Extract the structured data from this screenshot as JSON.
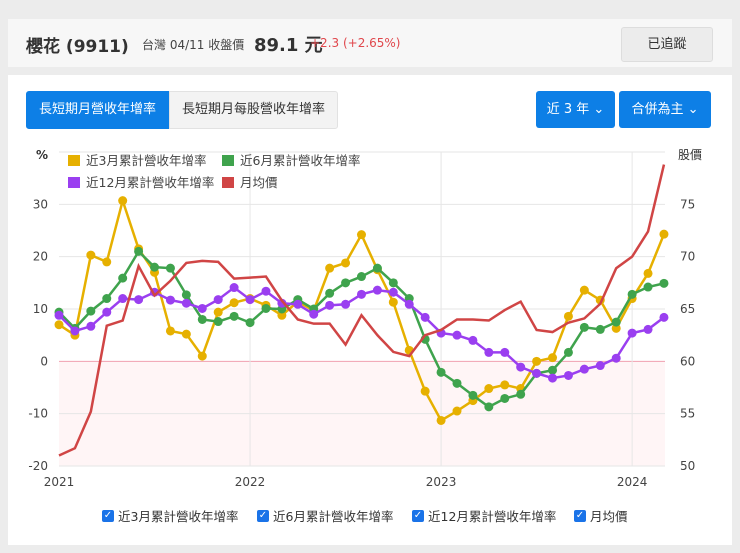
{
  "header": {
    "title": "櫻花 (9911)",
    "market_date": "台灣 04/11 收盤價",
    "price": "89.1 元",
    "change": "+2.3 (+2.65%)",
    "follow_label": "已追蹤"
  },
  "tabs": [
    {
      "label": "長短期月營收年增率"
    },
    {
      "label": "長短期月每股營收年增率"
    }
  ],
  "dropdowns": {
    "period": "近 3 年",
    "basis": "合併為主"
  },
  "colors": {
    "m3": "#e6b000",
    "m6": "#3fa34d",
    "m12": "#9a3ff0",
    "price": "#d04545"
  },
  "chart_data": {
    "type": "line",
    "left_axis": {
      "label": "%",
      "range": [
        -20,
        40
      ],
      "ticks": [
        -20,
        -10,
        0,
        10,
        20,
        30
      ]
    },
    "right_axis": {
      "label": "股價",
      "range": [
        50,
        80
      ],
      "ticks": [
        50,
        55,
        60,
        65,
        70,
        75
      ]
    },
    "x_start": "2021-01",
    "x_ticks": [
      "2021",
      "2022",
      "2023",
      "2024"
    ],
    "series": [
      {
        "name": "近3月累計營收年增率",
        "axis": "left",
        "values": [
          7,
          5,
          20.3,
          19,
          30.7,
          21.5,
          17,
          5.8,
          5.2,
          1,
          9.4,
          11.2,
          12,
          10.7,
          8.8,
          11.4,
          9.7,
          17.8,
          18.8,
          24.2,
          17.5,
          11.3,
          2.1,
          -5.7,
          -11.3,
          -9.5,
          -7.5,
          -5.2,
          -4.5,
          -5.2,
          0,
          0.7,
          8.6,
          13.6,
          11.7,
          6.3,
          12,
          16.8,
          24.3
        ]
      },
      {
        "name": "近6月累計營收年增率",
        "axis": "left",
        "values": [
          9.4,
          6.3,
          9.6,
          12,
          15.9,
          21,
          18,
          17.8,
          12.7,
          8,
          7.6,
          8.6,
          7.4,
          10.1,
          10,
          11.8,
          10,
          13,
          15,
          16.2,
          17.8,
          15,
          12,
          4.2,
          -2.1,
          -4.2,
          -6.5,
          -8.7,
          -7.1,
          -6.3,
          -2.3,
          -1.7,
          1.7,
          6.5,
          6.1,
          7.5,
          12.8,
          14.2,
          14.9
        ]
      },
      {
        "name": "近12月累計營收年增率",
        "axis": "left",
        "values": [
          8.8,
          5.8,
          6.7,
          9.4,
          12,
          11.8,
          13.2,
          11.7,
          11.1,
          10.1,
          11.8,
          14.1,
          11.8,
          13.4,
          11.1,
          10.9,
          9,
          10.7,
          10.9,
          12.8,
          13.6,
          13.2,
          10.9,
          8.4,
          5.4,
          5,
          4,
          1.7,
          1.7,
          -1.1,
          -2.3,
          -3.2,
          -2.7,
          -1.5,
          -0.8,
          0.6,
          5.4,
          6.1,
          8.4
        ]
      },
      {
        "name": "月均價",
        "axis": "right",
        "values": [
          51,
          51.7,
          55.2,
          63.4,
          63.9,
          69.1,
          66.3,
          67.7,
          69.4,
          69.6,
          69.5,
          67.9,
          68,
          68.1,
          65.8,
          64,
          63.6,
          63.6,
          61.6,
          64.4,
          62.5,
          60.9,
          60.5,
          62.5,
          63,
          64,
          64,
          63.9,
          64.9,
          65.7,
          63,
          62.8,
          63.7,
          64.1,
          65.5,
          68.9,
          70,
          72.4,
          78.8
        ]
      }
    ]
  },
  "check": "✓"
}
